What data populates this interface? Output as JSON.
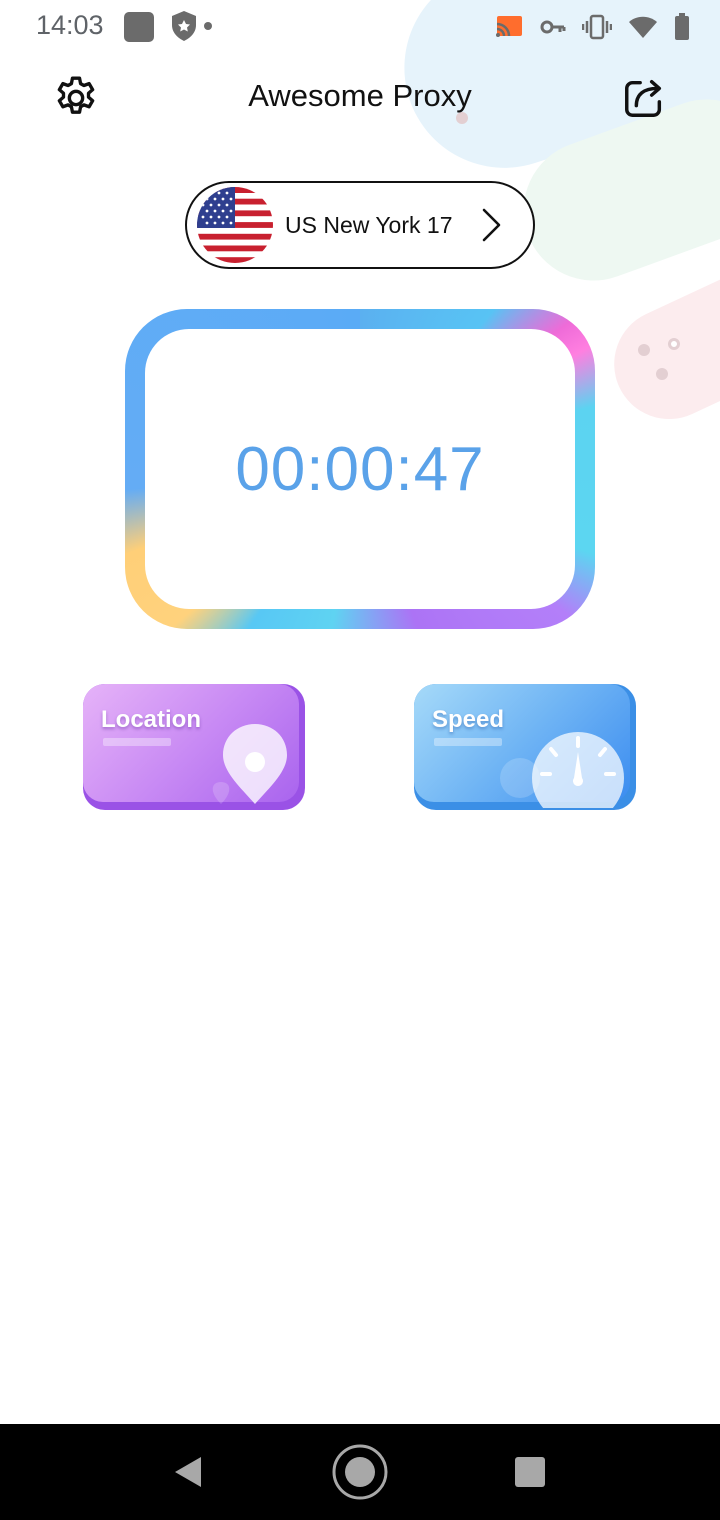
{
  "status_bar": {
    "time": "14:03",
    "left_icons": [
      "app-notification-icon",
      "shield-icon",
      "dot-icon"
    ],
    "right_icons": [
      "cast-icon",
      "vpn-key-icon",
      "vibrate-icon",
      "wifi-icon",
      "battery-icon"
    ]
  },
  "header": {
    "title": "Awesome Proxy",
    "left_icon": "gear-icon",
    "right_icon": "share-icon"
  },
  "server": {
    "flag": "us-flag-icon",
    "name": "US New York 17",
    "chevron": "chevron-right-icon"
  },
  "timer": {
    "value": "00:00:47"
  },
  "features": [
    {
      "label": "Location",
      "icon": "location-pin-icon"
    },
    {
      "label": "Speed",
      "icon": "speedometer-icon"
    }
  ],
  "nav": {
    "back": "back-icon",
    "home": "home-icon",
    "recents": "recents-icon"
  },
  "colors": {
    "timer_text": "#5aa2e9",
    "location_card": "#b97bf1",
    "speed_card": "#5aa6f3",
    "nav_bar": "#000000"
  }
}
